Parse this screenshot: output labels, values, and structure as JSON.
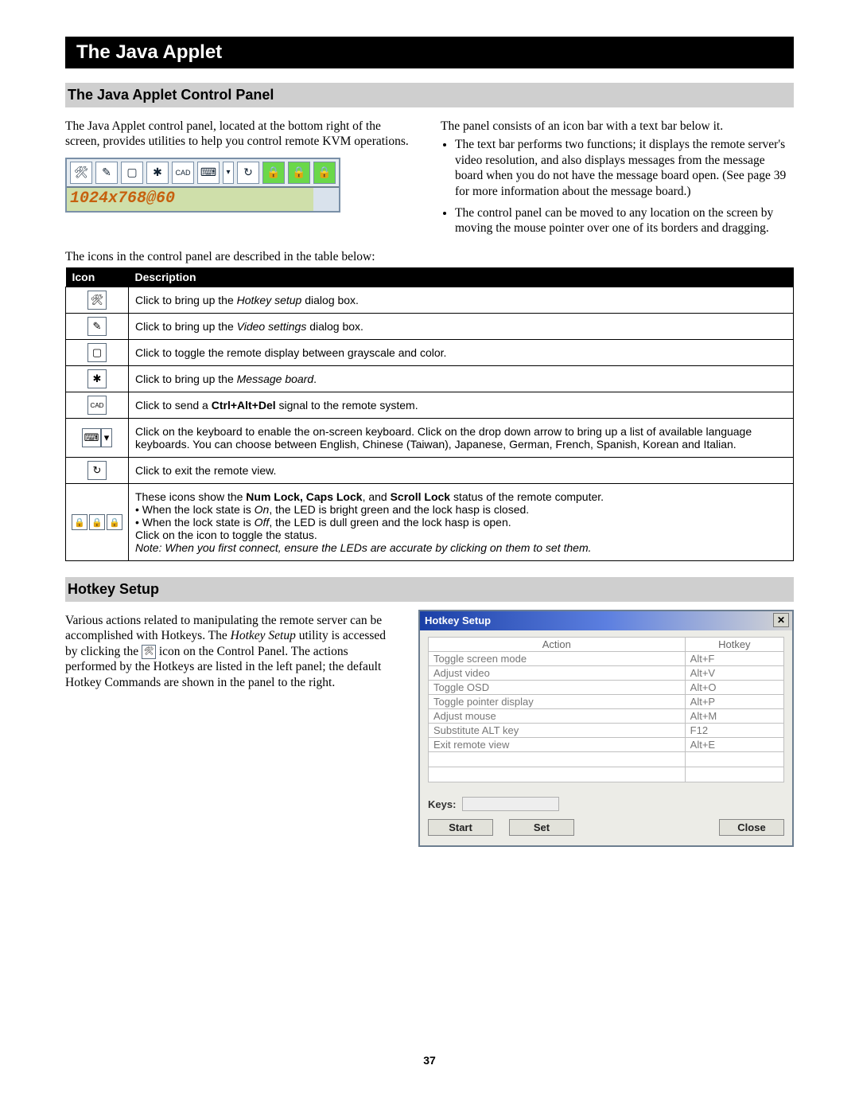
{
  "title_bar": "The Java Applet",
  "section1_heading": "The Java Applet Control Panel",
  "intro_left": "The Java Applet control panel, located at the bottom right of the screen, provides utilities to help you control remote KVM operations.",
  "intro_right": "The panel consists of an icon bar with a text bar below it.",
  "bullets_right": [
    "The text bar performs two functions; it displays the remote server's video resolution, and also displays messages from the message board when you do not have the message board open. (See page 39 for more information about the message board.)",
    "The control panel can be moved to any location on the screen by moving the mouse pointer over one of its borders and dragging."
  ],
  "cp_status_text": "1024x768@60",
  "cp_icons": [
    "🛠",
    "✎",
    "▢",
    "✱",
    "CAD",
    "⌨",
    "▾",
    "↻",
    "🔒",
    "🔒",
    "🔒"
  ],
  "table_lead": "The icons in the control panel are described in the table below:",
  "table_headers": {
    "icon": "Icon",
    "desc": "Description"
  },
  "icon_rows": [
    {
      "glyph": "🛠",
      "desc_parts": [
        "Click to bring up the ",
        "Hotkey setup",
        " dialog box."
      ],
      "italic_idx": 1
    },
    {
      "glyph": "✎",
      "desc_parts": [
        "Click to bring up the ",
        "Video settings",
        " dialog box."
      ],
      "italic_idx": 1
    },
    {
      "glyph": "▢",
      "desc_parts": [
        "Click to toggle the remote display between grayscale and color."
      ],
      "italic_idx": -1
    },
    {
      "glyph": "✱",
      "desc_parts": [
        "Click to bring up the ",
        "Message board",
        "."
      ],
      "italic_idx": 1
    },
    {
      "glyph": "CAD",
      "desc_parts": [
        "Click to send a ",
        "Ctrl+Alt+Del",
        " signal to the remote system."
      ],
      "bold_idx": 1
    },
    {
      "glyph": "⌨▾",
      "is_keyboard": true,
      "desc_parts": [
        "Click on the keyboard to enable the on-screen keyboard. Click on the drop down arrow to bring up a list of available language keyboards. You can choose between English, Chinese (Taiwan), Japanese, German, French, Spanish, Korean and Italian."
      ]
    },
    {
      "glyph": "↻",
      "desc_parts": [
        "Click to exit the remote view."
      ]
    },
    {
      "glyph": "locks",
      "is_locks": true,
      "desc_html": {
        "line1_a": "These icons show the ",
        "line1_b": "Num Lock, Caps Lock",
        "line1_c": ", and ",
        "line1_d": "Scroll Lock",
        "line1_e": " status of the remote computer.",
        "b1": "• When the lock state is ",
        "b1i": "On",
        "b1b": ", the LED is bright green and the lock hasp is closed.",
        "b2": "• When the lock state is ",
        "b2i": "Off",
        "b2b": ", the LED is dull green and the lock hasp is open.",
        "line4": "Click on the icon to toggle the status.",
        "note": "Note: When you first connect, ensure the LEDs are accurate by clicking on them to set them."
      }
    }
  ],
  "section2_heading": "Hotkey Setup",
  "hotkey_para": {
    "a": "Various actions related to manipulating the remote server can be accomplished with Hotkeys. The ",
    "b": "Hotkey Setup",
    "c": " utility is accessed by clicking the ",
    "d": " icon on the Control Panel. The actions performed by the Hotkeys are listed in the left panel; the default Hotkey Commands are shown in the panel to the right."
  },
  "hk_window": {
    "title": "Hotkey Setup",
    "close": "✕",
    "col_action": "Action",
    "col_hotkey": "Hotkey",
    "rows": [
      {
        "action": "Toggle screen mode",
        "hotkey": "Alt+F"
      },
      {
        "action": "Adjust video",
        "hotkey": "Alt+V"
      },
      {
        "action": "Toggle OSD",
        "hotkey": "Alt+O"
      },
      {
        "action": "Toggle pointer display",
        "hotkey": "Alt+P"
      },
      {
        "action": "Adjust mouse",
        "hotkey": "Alt+M"
      },
      {
        "action": "Substitute ALT key",
        "hotkey": "F12"
      },
      {
        "action": "Exit remote view",
        "hotkey": "Alt+E"
      }
    ],
    "keys_label": "Keys:",
    "btn_start": "Start",
    "btn_set": "Set",
    "btn_close": "Close"
  },
  "page_number": "37"
}
